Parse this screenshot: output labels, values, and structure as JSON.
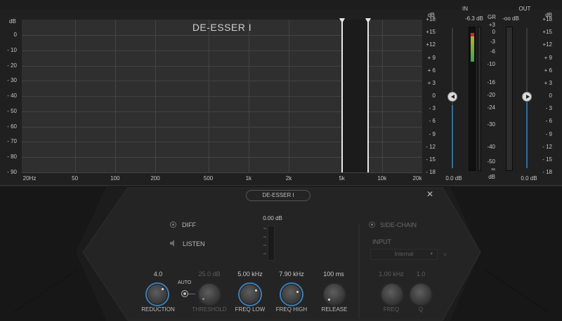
{
  "graph": {
    "title": "DE-ESSER I",
    "y_unit_left": "dB",
    "y_labels_left": [
      "0",
      "- 10",
      "- 20",
      "- 30",
      "- 40",
      "- 50",
      "- 60",
      "- 70",
      "- 80",
      "- 90"
    ],
    "y_unit_right": "dB",
    "y_labels_right": [
      "+18",
      "+15",
      "+12",
      "+ 9",
      "+ 6",
      "+ 3",
      "0",
      "- 3",
      "- 6",
      "- 9",
      "- 12",
      "- 15",
      "- 18"
    ],
    "x_labels": [
      "20Hz",
      "50",
      "100",
      "200",
      "500",
      "1k",
      "2k",
      "5k",
      "10k",
      "20k"
    ],
    "band_low_hz": 5000,
    "band_high_hz": 7900
  },
  "meters": {
    "in_label": "IN",
    "in_peak": "-6.3 dB",
    "gr_label": "GR",
    "out_label": "OUT",
    "out_peak": "-oo dB",
    "gr_scale": [
      "+3",
      "0",
      "-3",
      "-6",
      "-10",
      "-16",
      "-20",
      "-24",
      "-30",
      "-40",
      "-50",
      "∞",
      "dB"
    ],
    "out_unit": "dB",
    "out_scale": [
      "+18",
      "+15",
      "+12",
      "+ 9",
      "+ 6",
      "+ 3",
      "0",
      "- 3",
      "- 6",
      "- 9",
      "- 12",
      "- 15",
      "- 18"
    ],
    "in_gain": "0.0 dB",
    "out_gain": "0.0 dB",
    "in_level_fraction": 0.45
  },
  "panel": {
    "preset": "DE-ESSER I",
    "diff_label": "DIFF",
    "listen_label": "LISTEN",
    "center_readout": "0.00 dB",
    "sidechain_label": "SIDE-CHAIN",
    "input_label": "INPUT",
    "input_value": "Internal",
    "auto_label": "AUTO",
    "knobs": [
      {
        "value": "4.0",
        "label": "REDUCTION"
      },
      {
        "value": "25.0 dB",
        "label": "THRESHOLD"
      },
      {
        "value": "5.00 kHz",
        "label": "FREQ LOW"
      },
      {
        "value": "7.90 kHz",
        "label": "FREQ HIGH"
      },
      {
        "value": "100 ms",
        "label": "RELEASE"
      },
      {
        "value": "1.00 kHz",
        "label": "FREQ"
      },
      {
        "value": "1.0",
        "label": "Q"
      }
    ]
  },
  "colors": {
    "accent": "#3b7fb8",
    "meter_green": "#3aa84a",
    "meter_red": "#c8302f"
  }
}
